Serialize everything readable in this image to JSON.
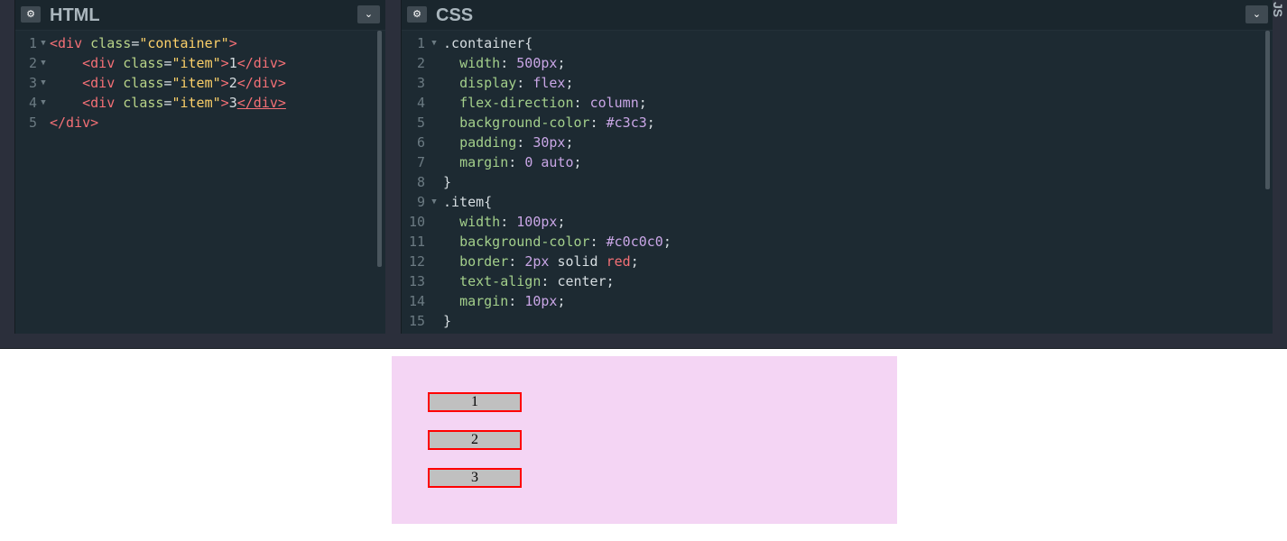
{
  "panels": {
    "html": {
      "title": "HTML"
    },
    "css": {
      "title": "CSS"
    },
    "js": {
      "title": "JS"
    }
  },
  "icons": {
    "settings": "gear-icon",
    "collapse": "chevron-down-icon"
  },
  "html_code": {
    "line_numbers": [
      "1",
      "2",
      "3",
      "4",
      "5"
    ],
    "l1": {
      "open": "<div ",
      "attr": "class",
      "eq": "=",
      "str": "\"container\"",
      "close": ">"
    },
    "l2": {
      "indent": "    ",
      "open": "<div ",
      "attr": "class",
      "eq": "=",
      "str": "\"item\"",
      "close": ">",
      "text": "1",
      "end": "</div>"
    },
    "l3": {
      "indent": "    ",
      "open": "<div ",
      "attr": "class",
      "eq": "=",
      "str": "\"item\"",
      "close": ">",
      "text": "2",
      "end": "</div>"
    },
    "l4": {
      "indent": "    ",
      "open": "<div ",
      "attr": "class",
      "eq": "=",
      "str": "\"item\"",
      "close": ">",
      "text": "3",
      "end": "</div>"
    },
    "l5": {
      "end": "</div>"
    }
  },
  "css_code": {
    "line_numbers": [
      "1",
      "2",
      "3",
      "4",
      "5",
      "6",
      "7",
      "8",
      "9",
      "10",
      "11",
      "12",
      "13",
      "14",
      "15"
    ],
    "l1": {
      "sel": ".container{"
    },
    "l2": {
      "prop": "width",
      "val": "500px"
    },
    "l3": {
      "prop": "display",
      "val": "flex"
    },
    "l4": {
      "prop": "flex-direction",
      "val": "column"
    },
    "l5": {
      "prop": "background-color",
      "val": "#c3c3"
    },
    "l6": {
      "prop": "padding",
      "val": "30px"
    },
    "l7": {
      "prop": "margin",
      "val": "0 auto"
    },
    "l8": {
      "sel": "}"
    },
    "l9": {
      "sel": ".item{"
    },
    "l10": {
      "prop": "width",
      "val": "100px"
    },
    "l11": {
      "prop": "background-color",
      "val": "#c0c0c0"
    },
    "l12": {
      "prop": "border",
      "val": "2px",
      "val2": "solid",
      "val3": "red"
    },
    "l13": {
      "prop": "text-align",
      "val": "center"
    },
    "l14": {
      "prop": "margin",
      "val": "10px"
    },
    "l15": {
      "sel": "}"
    }
  },
  "preview": {
    "items": [
      "1",
      "2",
      "3"
    ],
    "container_color": "#f4d5f4"
  }
}
